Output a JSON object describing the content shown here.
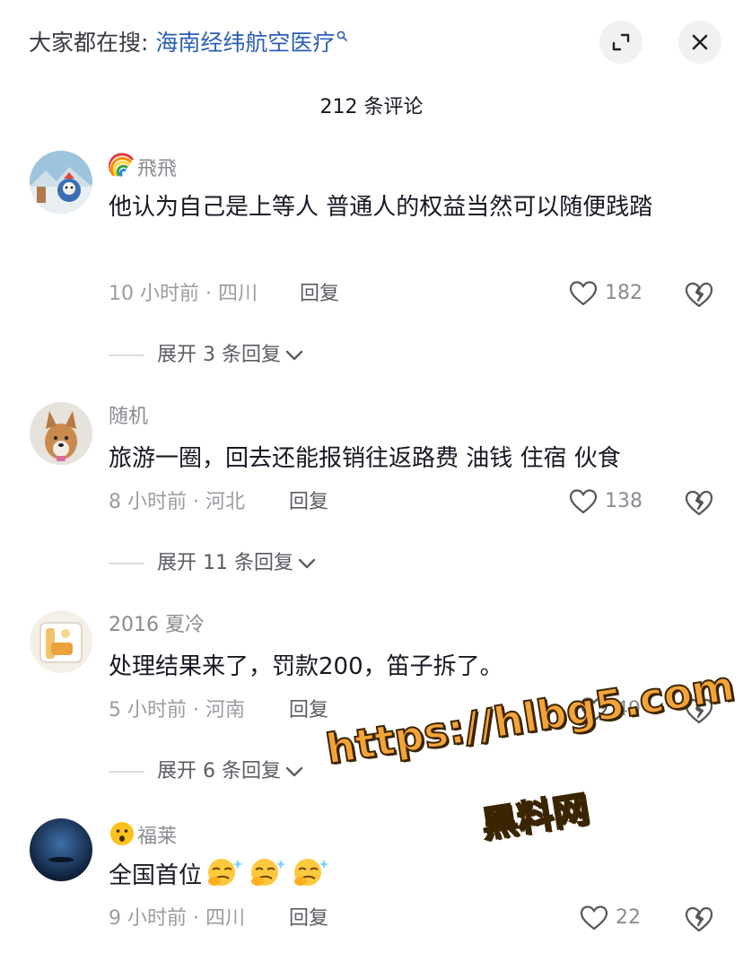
{
  "search": {
    "prefix": "大家都在搜: ",
    "term": "海南经纬航空医疗"
  },
  "header": {
    "comment_count": "212 条评论"
  },
  "comments": [
    {
      "username": "飛飛",
      "text": "他认为自己是上等人 普通人的权益当然可以随便践踏",
      "meta": "10 小时前 · 四川",
      "reply": "回复",
      "likes": "182",
      "expand": "展开 3 条回复"
    },
    {
      "username": "随机",
      "text": "旅游一圈，回去还能报销往返路费 油钱 住宿 伙食",
      "meta": "8 小时前 · 河北",
      "reply": "回复",
      "likes": "138",
      "expand": "展开 11 条回复"
    },
    {
      "username": "2016 夏冷",
      "text": "处理结果来了，罚款200，笛子拆了。",
      "meta": "5 小时前 · 河南",
      "reply": "回复",
      "likes": "49",
      "expand": "展开 6 条回复"
    },
    {
      "username": "福莱",
      "text": "全国首位",
      "meta": "9 小时前 · 四川",
      "reply": "回复",
      "likes": "22"
    }
  ],
  "watermark": {
    "url": "https://hlbg5.com",
    "name": "黑料网"
  },
  "icons": {
    "search_hint": "magnifier-icon",
    "expand": "expand-arrows-icon",
    "close": "close-icon",
    "like": "heart-outline-icon",
    "dislike": "broken-heart-icon",
    "chevron": "chevron-down-icon"
  },
  "colors": {
    "search_term": "#2b5fb4",
    "primary_text": "#161823",
    "secondary_text": "#9b9ca2",
    "watermark": "#f5a339"
  }
}
